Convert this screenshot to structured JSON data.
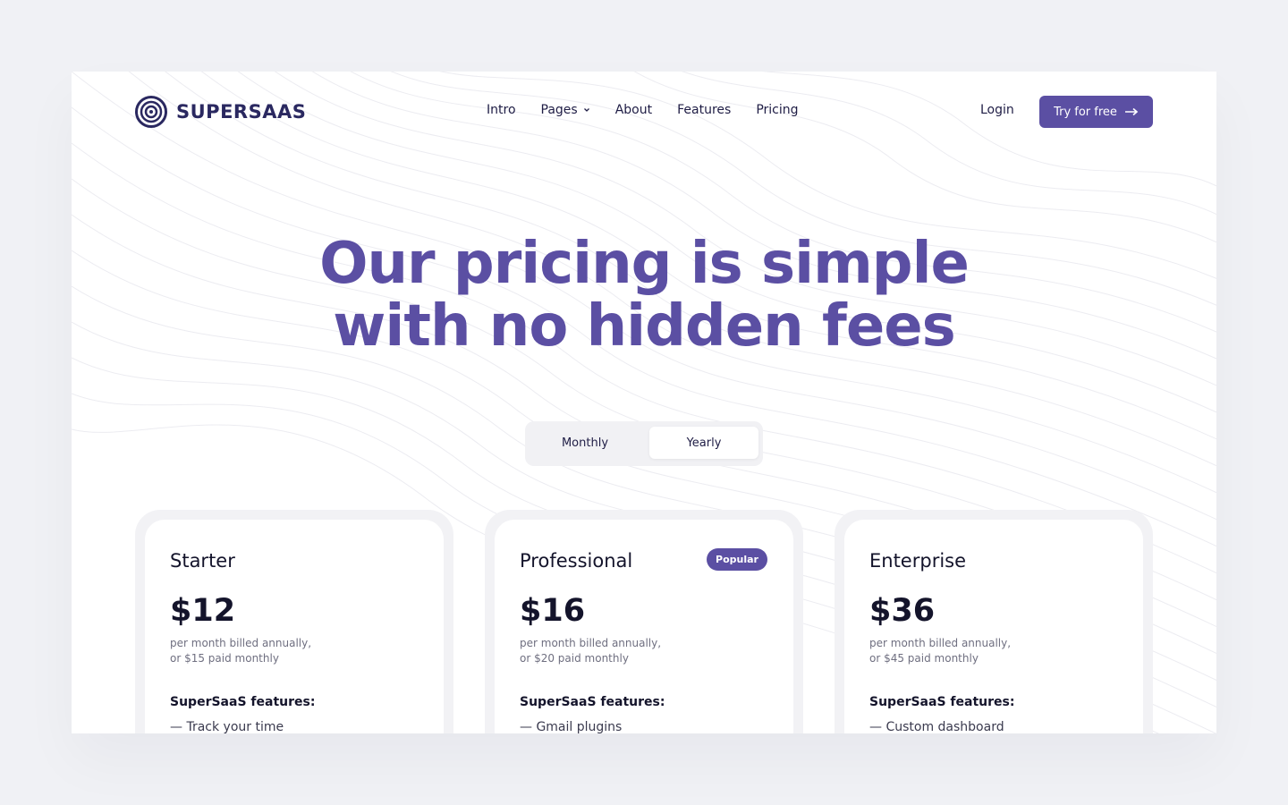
{
  "brand": {
    "name": "SUPERSAAS"
  },
  "nav": {
    "items": [
      {
        "label": "Intro",
        "has_dropdown": false
      },
      {
        "label": "Pages",
        "has_dropdown": true
      },
      {
        "label": "About",
        "has_dropdown": false
      },
      {
        "label": "Features",
        "has_dropdown": false
      },
      {
        "label": "Pricing",
        "has_dropdown": false
      }
    ],
    "login_label": "Login",
    "cta_label": "Try for free"
  },
  "hero": {
    "line1": "Our pricing is simple",
    "line2": "with no hidden fees"
  },
  "billing_toggle": {
    "options": [
      "Monthly",
      "Yearly"
    ],
    "selected": "Yearly"
  },
  "plans": [
    {
      "name": "Starter",
      "badge": "",
      "price": "$12",
      "note_line1": "per month billed annually,",
      "note_line2": "or $15 paid monthly",
      "features_title": "SuperSaaS features:",
      "first_feature": "— Track your time"
    },
    {
      "name": "Professional",
      "badge": "Popular",
      "price": "$16",
      "note_line1": "per month billed annually,",
      "note_line2": "or $20 paid monthly",
      "features_title": "SuperSaaS features:",
      "first_feature": "— Gmail plugins"
    },
    {
      "name": "Enterprise",
      "badge": "",
      "price": "$36",
      "note_line1": "per month billed annually,",
      "note_line2": "or $45 paid monthly",
      "features_title": "SuperSaaS features:",
      "first_feature": "— Custom dashboard"
    }
  ],
  "colors": {
    "accent": "#5b4fa3",
    "brand_dark": "#2a2860",
    "page_bg": "#f0f1f5"
  }
}
